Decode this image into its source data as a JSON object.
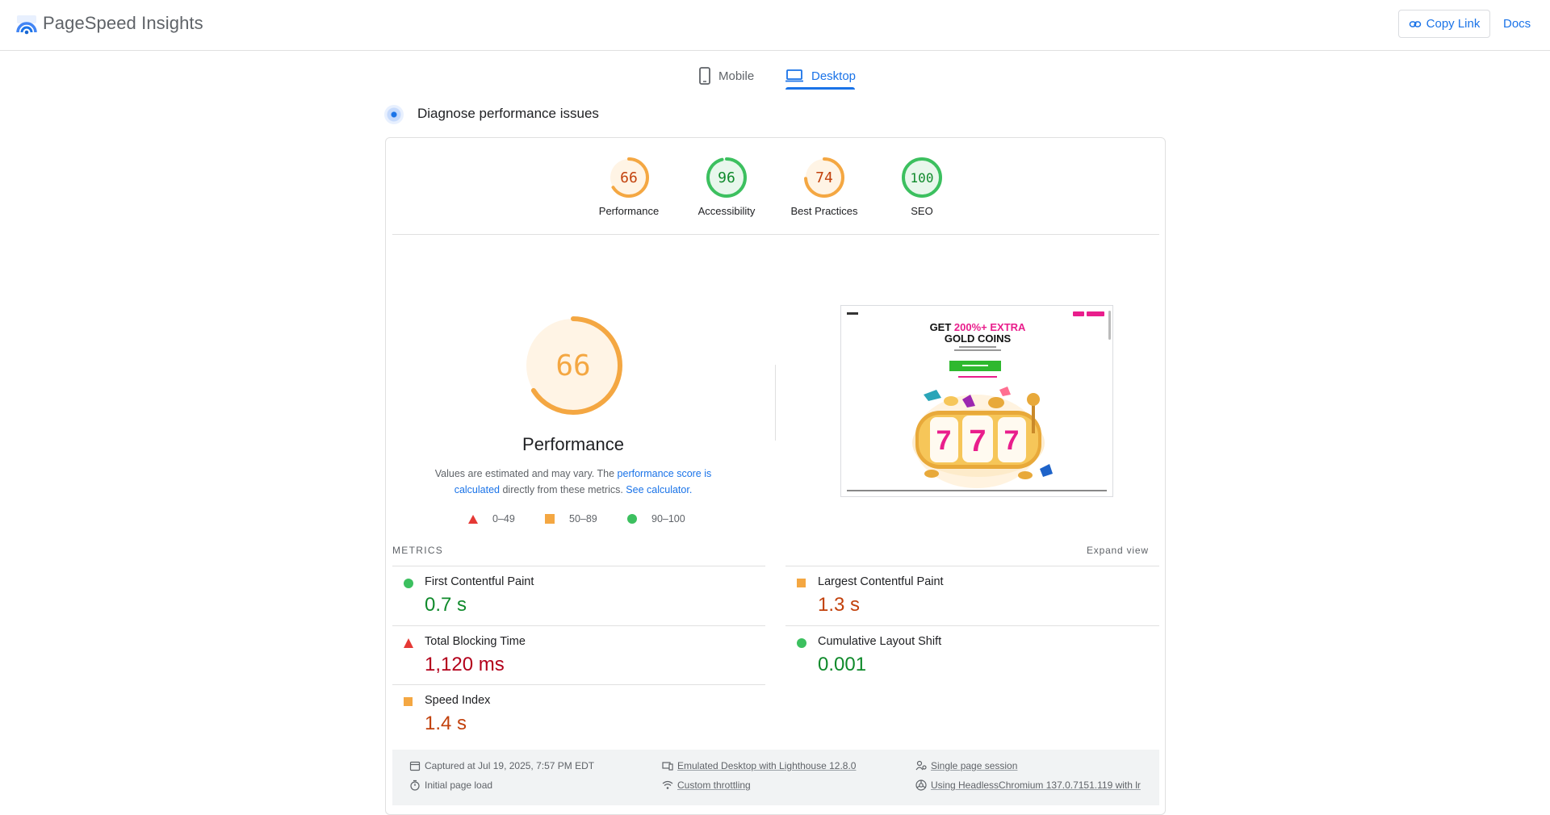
{
  "header": {
    "app_title": "PageSpeed Insights",
    "copy_link_label": "Copy Link",
    "docs_label": "Docs"
  },
  "tabs": [
    {
      "label": "Mobile",
      "icon": "phone-icon",
      "selected": false
    },
    {
      "label": "Desktop",
      "icon": "laptop-icon",
      "selected": true
    }
  ],
  "diagnose_title": "Diagnose performance issues",
  "scores": [
    {
      "value": "66",
      "label": "Performance",
      "status": "average"
    },
    {
      "value": "96",
      "label": "Accessibility",
      "status": "pass"
    },
    {
      "value": "74",
      "label": "Best Practices",
      "status": "average"
    },
    {
      "value": "100",
      "label": "SEO",
      "status": "pass"
    }
  ],
  "performance": {
    "score": "66",
    "label": "Performance",
    "explain_prefix": "Values are estimated and may vary. The ",
    "explain_link1": "performance score is calculated",
    "explain_middle": " directly from these metrics. ",
    "explain_link2": "See calculator."
  },
  "legend": [
    {
      "range": "0–49",
      "shape": "triangle",
      "color": "#e53935"
    },
    {
      "range": "50–89",
      "shape": "square",
      "color": "#f4a742"
    },
    {
      "range": "90–100",
      "shape": "circle",
      "color": "#3cc05f"
    }
  ],
  "screenshot": {
    "headline_line1_a": "GET ",
    "headline_line1_b": "200%+ EXTRA",
    "headline_line2": "GOLD COINS"
  },
  "metrics": {
    "title": "METRICS",
    "expand_label": "Expand view",
    "items": [
      {
        "name": "First Contentful Paint",
        "value": "0.7 s",
        "status": "pass"
      },
      {
        "name": "Largest Contentful Paint",
        "value": "1.3 s",
        "status": "average"
      },
      {
        "name": "Total Blocking Time",
        "value": "1,120 ms",
        "status": "fail"
      },
      {
        "name": "Cumulative Layout Shift",
        "value": "0.001",
        "status": "pass"
      },
      {
        "name": "Speed Index",
        "value": "1.4 s",
        "status": "average"
      }
    ]
  },
  "info": {
    "captured": "Captured at Jul 19, 2025, 7:57 PM EDT",
    "initial_load": "Initial page load",
    "emulated": "Emulated Desktop with Lighthouse 12.8.0",
    "throttling": "Custom throttling",
    "session": "Single page session",
    "browser": "Using HeadlessChromium 137.0.7151.119 with lr"
  },
  "colors": {
    "accent": "#1a73e8",
    "pass": "#3cc05f",
    "average": "#f4a742",
    "fail": "#e53935",
    "pass_text": "#0f8a2b",
    "average_text": "#c2410c",
    "fail_text": "#b3001b"
  }
}
